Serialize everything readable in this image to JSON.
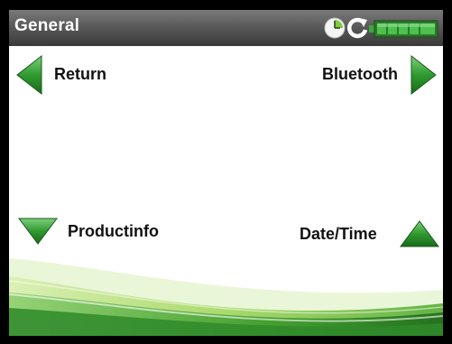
{
  "titlebar": {
    "title": "General"
  },
  "status": {
    "icons": [
      "clock-icon",
      "refresh-icon",
      "battery-icon"
    ],
    "battery_level": 1.0
  },
  "nav": {
    "return_label": "Return",
    "bluetooth_label": "Bluetooth",
    "productinfo_label": "Productinfo",
    "datetime_label": "Date/Time"
  },
  "colors": {
    "accent_green": "#3aa83a",
    "dark_green": "#1e6e1e",
    "titlebar": "#555555"
  }
}
